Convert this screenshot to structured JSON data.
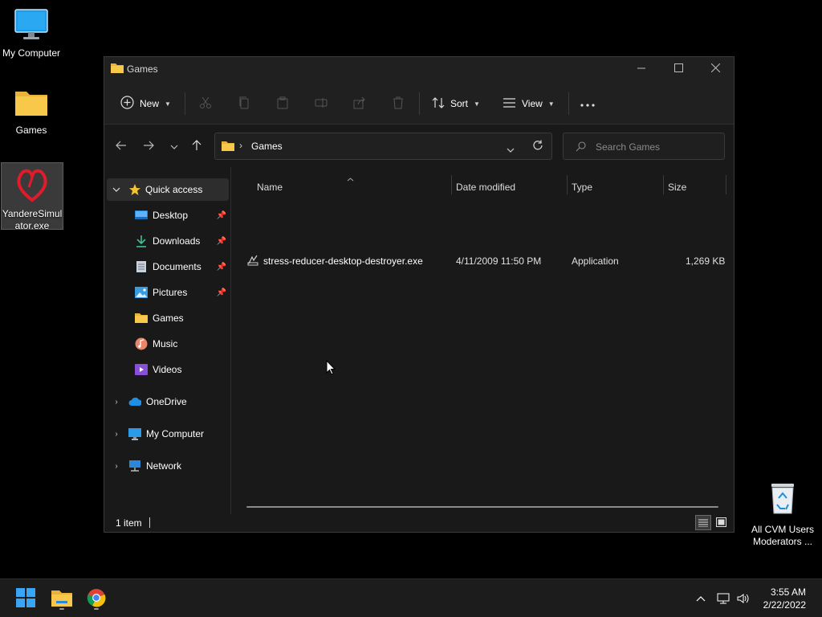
{
  "desktop": {
    "icons": [
      {
        "label": "My Computer",
        "icon": "monitor-icon"
      },
      {
        "label": "Games",
        "icon": "folder-icon"
      },
      {
        "label": "YandereSimulator.exe",
        "label_line1": "YandereSimul",
        "label_line2": "ator.exe",
        "icon": "heart-app-icon"
      },
      {
        "label": "All CVM Users Moderators ...",
        "label_line1": "All CVM Users",
        "label_line2": "Moderators ...",
        "icon": "recycle-bin-icon"
      }
    ]
  },
  "window": {
    "title": "Games",
    "controls": {
      "minimize": "minimize-icon",
      "maximize": "maximize-icon",
      "close": "close-icon"
    },
    "commandbar": {
      "new_label": "New",
      "sort_label": "Sort",
      "view_label": "View",
      "icons": [
        "cut-icon",
        "copy-icon",
        "paste-icon",
        "rename-icon",
        "share-icon",
        "delete-icon",
        "more-icon"
      ]
    },
    "address": {
      "path": [
        "Games"
      ],
      "current": "Games"
    },
    "search": {
      "placeholder": "Search Games"
    },
    "navpane": {
      "quick_access": "Quick access",
      "items": [
        {
          "label": "Desktop",
          "icon": "desktop-icon",
          "pinned": true
        },
        {
          "label": "Downloads",
          "icon": "download-icon",
          "pinned": true
        },
        {
          "label": "Documents",
          "icon": "document-icon",
          "pinned": true
        },
        {
          "label": "Pictures",
          "icon": "pictures-icon",
          "pinned": true
        },
        {
          "label": "Games",
          "icon": "folder-icon",
          "pinned": false
        },
        {
          "label": "Music",
          "icon": "music-icon",
          "pinned": false
        },
        {
          "label": "Videos",
          "icon": "videos-icon",
          "pinned": false
        }
      ],
      "roots": [
        {
          "label": "OneDrive",
          "icon": "cloud-icon"
        },
        {
          "label": "My Computer",
          "icon": "monitor-icon"
        },
        {
          "label": "Network",
          "icon": "network-icon"
        }
      ]
    },
    "columns": [
      "Name",
      "Date modified",
      "Type",
      "Size"
    ],
    "files": [
      {
        "name": "stress-reducer-desktop-destroyer.exe",
        "date_modified": "4/11/2009 11:50 PM",
        "type": "Application",
        "size": "1,269 KB"
      }
    ],
    "status": {
      "count": "1 item"
    }
  },
  "taskbar": {
    "apps": [
      "windows-start-icon",
      "file-explorer-icon",
      "chrome-icon"
    ],
    "clock": {
      "time": "3:55 AM",
      "date": "2/22/2022"
    }
  },
  "colors": {
    "accent": "#0078d4",
    "window_bg": "#191919",
    "titlebar_bg": "#202020",
    "folder": "#f8c84a"
  }
}
